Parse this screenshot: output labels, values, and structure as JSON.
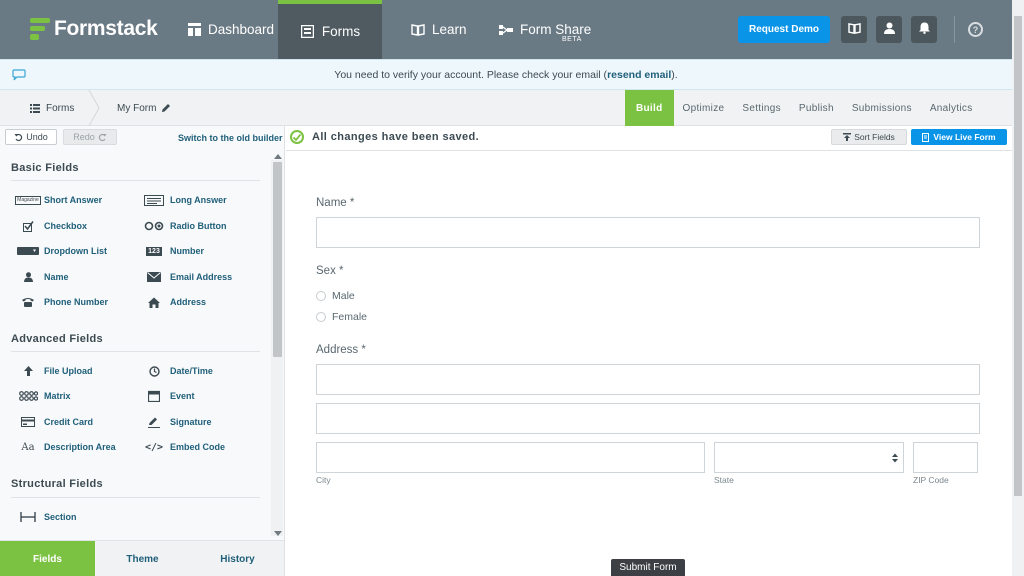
{
  "brand": {
    "name": "Formstack"
  },
  "nav": {
    "items": [
      {
        "label": "Dashboard",
        "icon": "dashboard-icon"
      },
      {
        "label": "Forms",
        "icon": "forms-icon",
        "active": true
      },
      {
        "label": "Learn",
        "icon": "book-icon"
      },
      {
        "label": "Form Share",
        "icon": "share-icon",
        "badge": "BETA"
      }
    ],
    "request_demo": "Request Demo",
    "help": "?"
  },
  "notice": {
    "text_before": "You need to verify your account. Please check your email (",
    "link": "resend email",
    "text_after": ")."
  },
  "breadcrumb": {
    "root": "Forms",
    "current": "My Form"
  },
  "tabs": [
    "Build",
    "Optimize",
    "Settings",
    "Publish",
    "Submissions",
    "Analytics"
  ],
  "builder": {
    "undo": "Undo",
    "redo": "Redo",
    "old_builder": "Switch to the old builder",
    "saved_status": "All changes have been saved.",
    "sort_fields": "Sort Fields",
    "view_live": "View Live Form"
  },
  "palette": {
    "basic_title": "Basic Fields",
    "basic": [
      "Short Answer",
      "Long Answer",
      "Checkbox",
      "Radio Button",
      "Dropdown List",
      "Number",
      "Name",
      "Email Address",
      "Phone Number",
      "Address"
    ],
    "advanced_title": "Advanced Fields",
    "advanced": [
      "File Upload",
      "Date/Time",
      "Matrix",
      "Event",
      "Credit Card",
      "Signature",
      "Description Area",
      "Embed Code"
    ],
    "structural_title": "Structural Fields",
    "structural": [
      "Section"
    ],
    "icon_text_short": "Magazine",
    "icon_text_number": "123",
    "icon_text_desc": "Aa",
    "icon_text_embed": "</>"
  },
  "panel_tabs": [
    "Fields",
    "Theme",
    "History"
  ],
  "form": {
    "name_label": "Name *",
    "sex_label": "Sex *",
    "sex_options": [
      "Male",
      "Female"
    ],
    "address_label": "Address *",
    "city_label": "City",
    "state_label": "State",
    "zip_label": "ZIP Code",
    "submit": "Submit Form"
  },
  "colors": {
    "accent_green": "#7cc242",
    "primary_blue": "#0a94e8",
    "nav_bg": "#6a7a84"
  }
}
